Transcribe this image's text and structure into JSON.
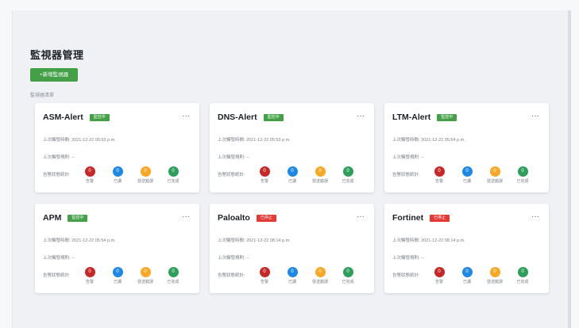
{
  "page": {
    "title": "監視器管理",
    "add_button": "+新增監視器",
    "section_label": "監視器清單"
  },
  "colors": {
    "green": "#43a047",
    "red": "#e53935",
    "error": "#c62828",
    "blue": "#1e88e5",
    "amber": "#f9a825",
    "done": "#2e9e5b"
  },
  "row_labels": {
    "last_check": "上次觸發時間:",
    "next_check": "上次觸發規則:",
    "alert_status": "告警狀態統計:"
  },
  "status_labels": [
    "告警",
    "已讀",
    "發送錯誤",
    "已完成"
  ],
  "status_icons": [
    "error-dot-icon",
    "read-dot-icon",
    "send-error-dot-icon",
    "done-dot-icon"
  ],
  "monitors": [
    {
      "name": "ASM-Alert",
      "status": "監控中",
      "last_check": "2021-12-22 05:53 p.m.",
      "next_check": "--",
      "counts": [
        "0",
        "0",
        "0",
        "0"
      ]
    },
    {
      "name": "DNS-Alert",
      "status": "監控中",
      "last_check": "2021-12-22 05:53 p.m.",
      "next_check": "--",
      "counts": [
        "0",
        "0",
        "0",
        "0"
      ]
    },
    {
      "name": "LTM-Alert",
      "status": "監控中",
      "last_check": "2021-12-22 05:54 p.m.",
      "next_check": "--",
      "counts": [
        "0",
        "0",
        "0",
        "0"
      ]
    },
    {
      "name": "APM",
      "status": "監控中",
      "last_check": "2021-12-22 05:54 p.m.",
      "next_check": "--",
      "counts": [
        "0",
        "0",
        "0",
        "0"
      ]
    },
    {
      "name": "Paloalto",
      "status": "已停止",
      "last_check": "2021-12-22 08:14 p.m.",
      "next_check": "--",
      "counts": [
        "0",
        "0",
        "0",
        "0"
      ]
    },
    {
      "name": "Fortinet",
      "status": "已停止",
      "last_check": "2021-12-22 08:14 p.m.",
      "next_check": "--",
      "counts": [
        "0",
        "0",
        "0",
        "0"
      ]
    }
  ],
  "card_menu": "···"
}
